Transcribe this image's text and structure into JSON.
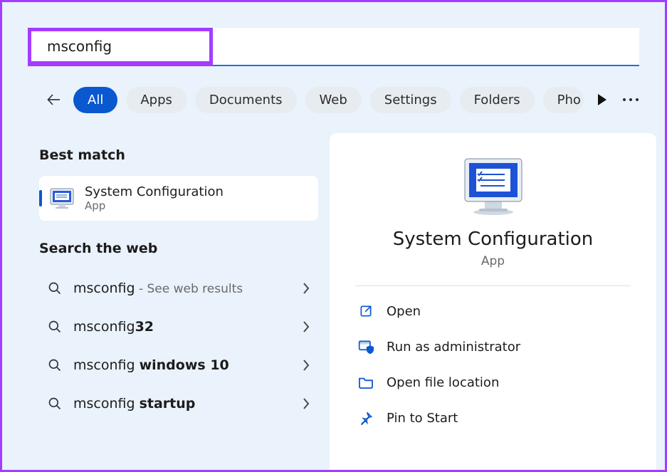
{
  "search": {
    "value": "msconfig",
    "placeholder": ""
  },
  "filters": {
    "items": [
      {
        "label": "All",
        "active": true
      },
      {
        "label": "Apps",
        "active": false
      },
      {
        "label": "Documents",
        "active": false
      },
      {
        "label": "Web",
        "active": false
      },
      {
        "label": "Settings",
        "active": false
      },
      {
        "label": "Folders",
        "active": false
      },
      {
        "label": "Pho",
        "active": false
      }
    ]
  },
  "sections": {
    "best_match": "Best match",
    "search_web": "Search the web"
  },
  "best": {
    "title": "System Configuration",
    "subtitle": "App"
  },
  "web": [
    {
      "prefix": "msconfig",
      "bold": "",
      "extra": " - See web results"
    },
    {
      "prefix": "msconfig",
      "bold": "32",
      "extra": ""
    },
    {
      "prefix": "msconfig ",
      "bold": "windows 10",
      "extra": ""
    },
    {
      "prefix": "msconfig ",
      "bold": "startup",
      "extra": ""
    }
  ],
  "detail": {
    "title": "System Configuration",
    "subtitle": "App",
    "actions": [
      {
        "icon": "open-external-icon",
        "label": "Open"
      },
      {
        "icon": "shield-run-icon",
        "label": "Run as administrator"
      },
      {
        "icon": "folder-icon",
        "label": "Open file location"
      },
      {
        "icon": "pin-icon",
        "label": "Pin to Start"
      }
    ]
  }
}
